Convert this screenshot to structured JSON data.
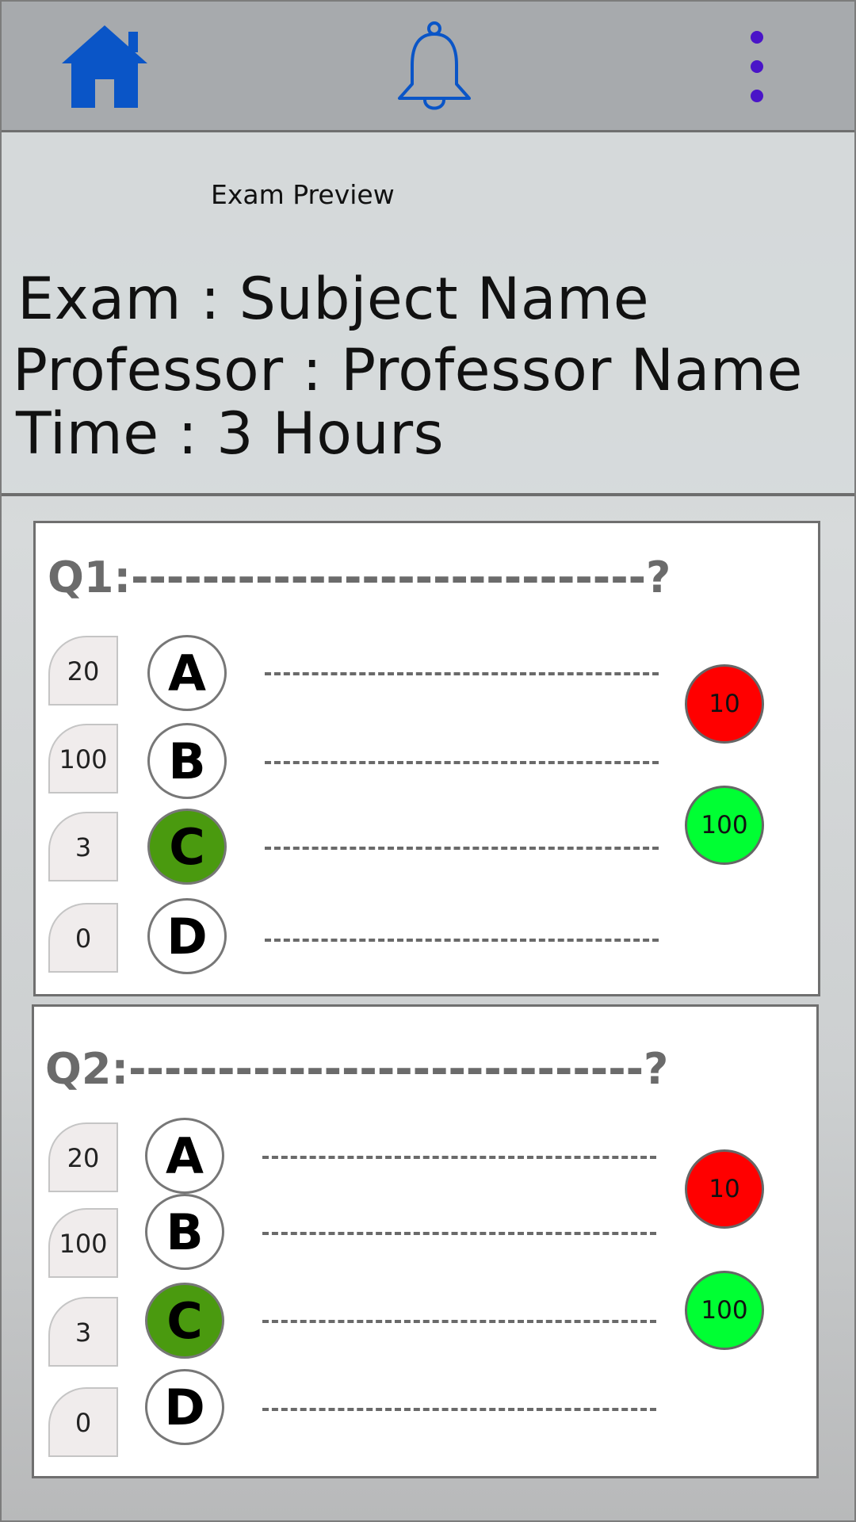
{
  "nav": {
    "home_icon": "home-icon",
    "bell_icon": "bell-icon",
    "menu_icon": "more-vertical-icon"
  },
  "header": {
    "subtitle": "Exam Preview",
    "exam_line": "Exam : Subject Name",
    "professor_line": "Professor : Professor Name",
    "time_line": "Time : 3 Hours"
  },
  "questions": [
    {
      "title": "Q1:-----------------------------?",
      "options": [
        {
          "letter": "A",
          "count": "20",
          "selected": false,
          "text": "--------------------"
        },
        {
          "letter": "B",
          "count": "100",
          "selected": false,
          "text": "--------------------"
        },
        {
          "letter": "C",
          "count": "3",
          "selected": true,
          "text": "--------------------"
        },
        {
          "letter": "D",
          "count": "0",
          "selected": false,
          "text": "--------------------"
        }
      ],
      "scores": {
        "wrong": "10",
        "right": "100"
      }
    },
    {
      "title": "Q2:-----------------------------?",
      "options": [
        {
          "letter": "A",
          "count": "20",
          "selected": false,
          "text": "--------------------"
        },
        {
          "letter": "B",
          "count": "100",
          "selected": false,
          "text": "--------------------"
        },
        {
          "letter": "C",
          "count": "3",
          "selected": true,
          "text": "--------------------"
        },
        {
          "letter": "D",
          "count": "0",
          "selected": false,
          "text": "--------------------"
        }
      ],
      "scores": {
        "wrong": "10",
        "right": "100"
      }
    }
  ],
  "colors": {
    "accent": "#0a55c7",
    "menu_dots": "#4a14c8",
    "selected_option": "#4a9a0f",
    "wrong_score": "#ff0000",
    "right_score": "#00ff33"
  }
}
